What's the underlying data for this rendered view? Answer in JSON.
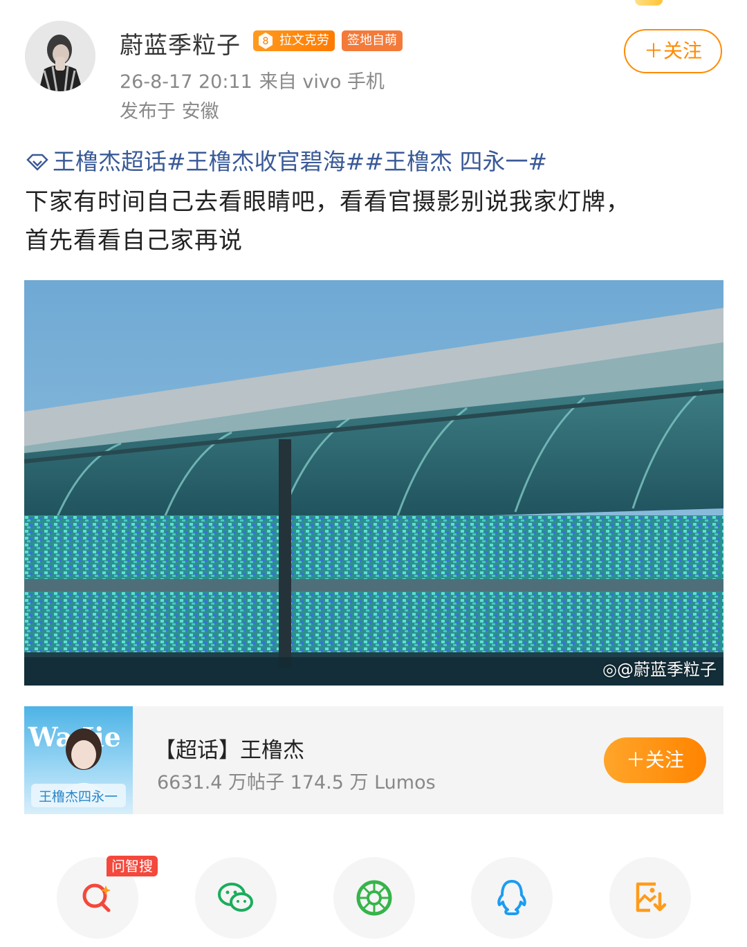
{
  "post": {
    "username": "蔚蓝季粒子",
    "level_badge": "拉文克劳",
    "level_number": "8",
    "sign_badge": "签地自萌",
    "time": "26-8-17 20:11",
    "source": "来自 vivo 手机",
    "location": "发布于 安徽",
    "follow_label": "＋关注",
    "topics": "王橹杰超话#王橹杰收官碧海##王橹杰 四永一#",
    "text_lines": [
      "下家有时间自己去看眼睛吧，看看官摄影别说我家灯牌，",
      "首先看看自己家再说"
    ],
    "image_watermark": "@蔚蓝季粒子"
  },
  "topic_card": {
    "title": "【超话】王橹杰",
    "stats": "6631.4 万帖子 174.5 万 Lumos",
    "follow_label": "＋关注",
    "thumb_text_top": "Wa    Jie",
    "thumb_text_main": "王橹杰四永一"
  },
  "share_bar": {
    "ask_badge": "问智搜",
    "icons": [
      "search-ai-icon",
      "wechat-icon",
      "moments-icon",
      "qq-icon",
      "save-image-icon"
    ]
  },
  "colors": {
    "accent_orange": "#ff8a00",
    "topic_link": "#3a5a97",
    "badge_red": "#f4483c"
  }
}
